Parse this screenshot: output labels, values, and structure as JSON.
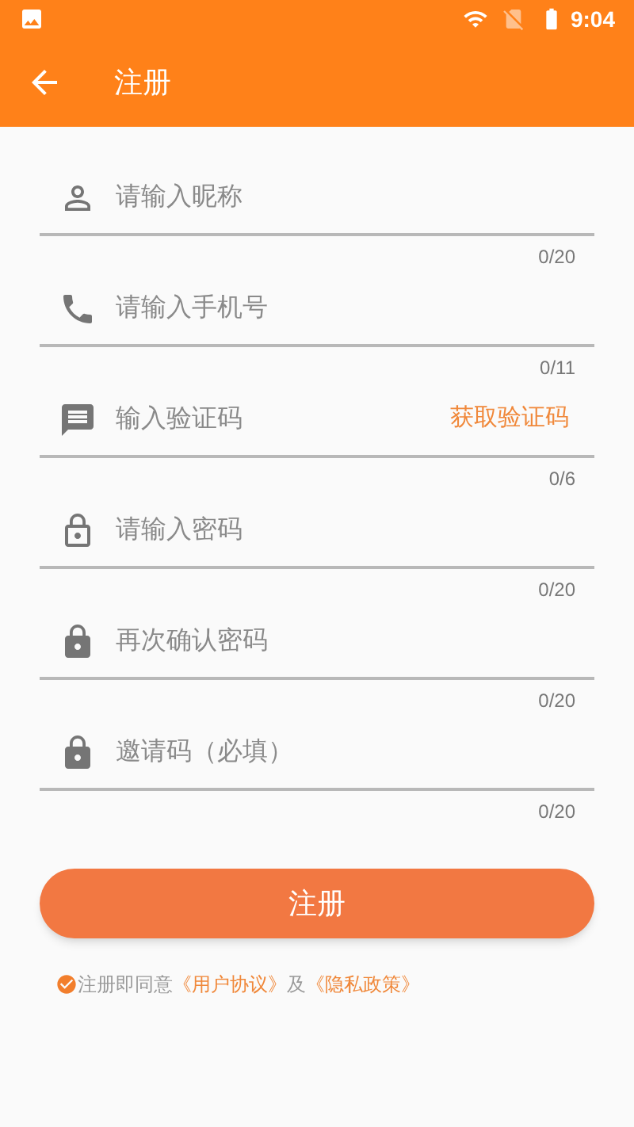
{
  "status_bar": {
    "time": "9:04"
  },
  "app_bar": {
    "title": "注册"
  },
  "fields": [
    {
      "kind": "person",
      "placeholder": "请输入昵称",
      "counter": "0/20"
    },
    {
      "kind": "phone",
      "placeholder": "请输入手机号",
      "counter": "0/11"
    },
    {
      "kind": "message",
      "placeholder": "输入验证码",
      "counter": "0/6",
      "action": "获取验证码"
    },
    {
      "kind": "lock_outline",
      "placeholder": "请输入密码",
      "counter": "0/20"
    },
    {
      "kind": "lock",
      "placeholder": "再次确认密码",
      "counter": "0/20"
    },
    {
      "kind": "lock",
      "placeholder": "邀请码（必填）",
      "counter": "0/20"
    }
  ],
  "submit_button": "注册",
  "agreement": {
    "checked": true,
    "prefix": "注册即同意",
    "user_agreement": "《用户协议》",
    "conjunction": "及",
    "privacy_policy": "《隐私政策》"
  }
}
